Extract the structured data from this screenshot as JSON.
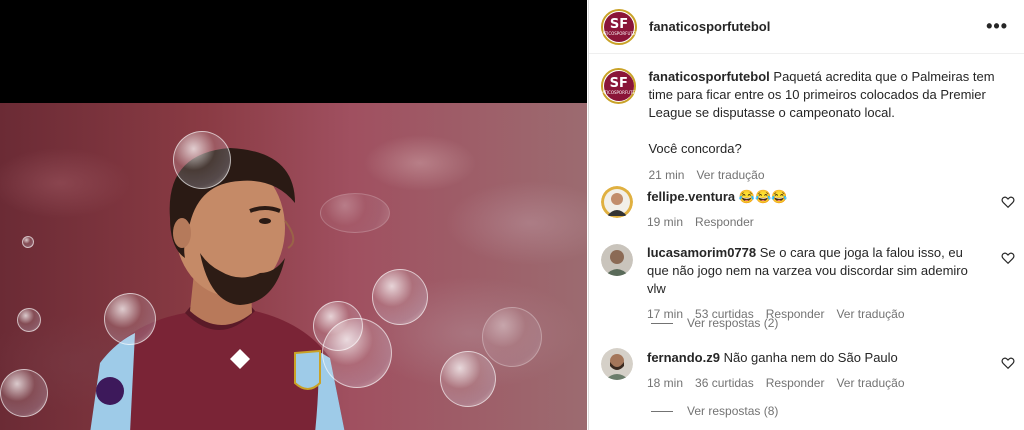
{
  "post": {
    "account": "fanaticosporfutebol",
    "avatar_text": "SF",
    "avatar_subtext": "FANATICOSPORFUTEBOL",
    "more_icon": "more-horizontal-icon"
  },
  "caption": {
    "username": "fanaticosporfutebol",
    "text": "Paquetá acredita que o Palmeiras tem time para ficar entre os 10 primeiros colocados da Premier League se disputasse o campeonato local.",
    "question": "Você concorda?",
    "time": "21 min",
    "translate": "Ver tradução"
  },
  "comments": [
    {
      "username": "fellipe.ventura",
      "text": "😂😂😂",
      "time": "19 min",
      "likes": "",
      "reply": "Responder",
      "translate": "",
      "view_replies": ""
    },
    {
      "username": "lucasamorim0778",
      "text": "Se o cara que joga la falou isso, eu que não jogo nem na varzea vou discordar sim ademiro vlw",
      "time": "17 min",
      "likes": "53 curtidas",
      "reply": "Responder",
      "translate": "Ver tradução",
      "view_replies": "Ver respostas (2)"
    },
    {
      "username": "fernando.z9",
      "text": "Não ganha nem do São Paulo",
      "time": "18 min",
      "likes": "36 curtidas",
      "reply": "Responder",
      "translate": "Ver tradução",
      "view_replies": "Ver respostas (8)"
    }
  ],
  "colors": {
    "brand_maroon": "#8a1538",
    "brand_gold": "#c9a227",
    "muted": "#737373",
    "text": "#262626"
  }
}
